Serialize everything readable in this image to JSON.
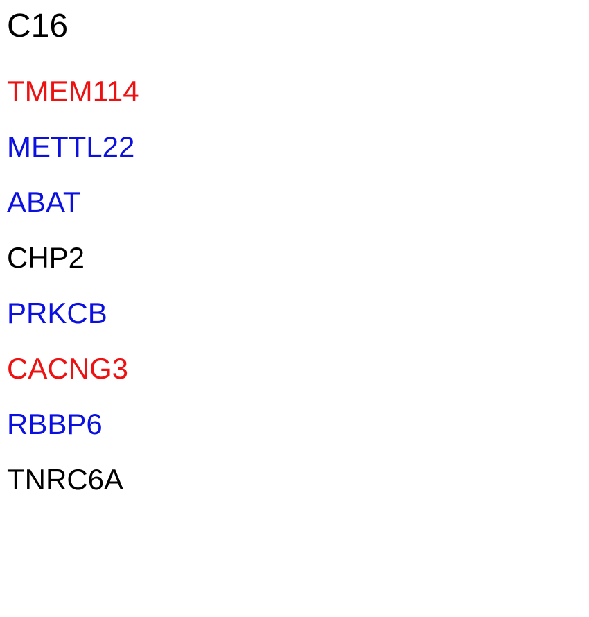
{
  "title": "C16",
  "colors": {
    "red": "#ee1111",
    "blue": "#0b10e0",
    "black": "#000000"
  },
  "genes": [
    {
      "name": "TMEM114",
      "color": "red"
    },
    {
      "name": "METTL22",
      "color": "blue"
    },
    {
      "name": "ABAT",
      "color": "blue"
    },
    {
      "name": "CHP2",
      "color": "black"
    },
    {
      "name": "PRKCB",
      "color": "blue"
    },
    {
      "name": "CACNG3",
      "color": "red"
    },
    {
      "name": "RBBP6",
      "color": "blue"
    },
    {
      "name": "TNRC6A",
      "color": "black"
    }
  ]
}
